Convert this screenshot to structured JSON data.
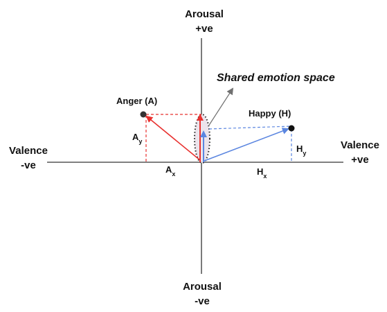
{
  "labels": {
    "arousal_pos_1": "Arousal",
    "arousal_pos_2": "+ve",
    "arousal_neg_1": "Arousal",
    "arousal_neg_2": "-ve",
    "valence_neg_1": "Valence",
    "valence_neg_2": "-ve",
    "valence_pos_1": "Valence",
    "valence_pos_2": "+ve",
    "shared_space": "Shared emotion space",
    "anger": "Anger (A)",
    "happy": "Happy (H)",
    "ax_main": "A",
    "ax_sub": "x",
    "ay_main": "A",
    "ay_sub": "y",
    "hx_main": "H",
    "hx_sub": "x",
    "hy_main": "H",
    "hy_sub": "y"
  },
  "colors": {
    "anger": "#e8312f",
    "happy": "#5b86e0",
    "axis": "#333333",
    "pointer": "#707070",
    "ellipse_fill": "#ece4ec"
  }
}
